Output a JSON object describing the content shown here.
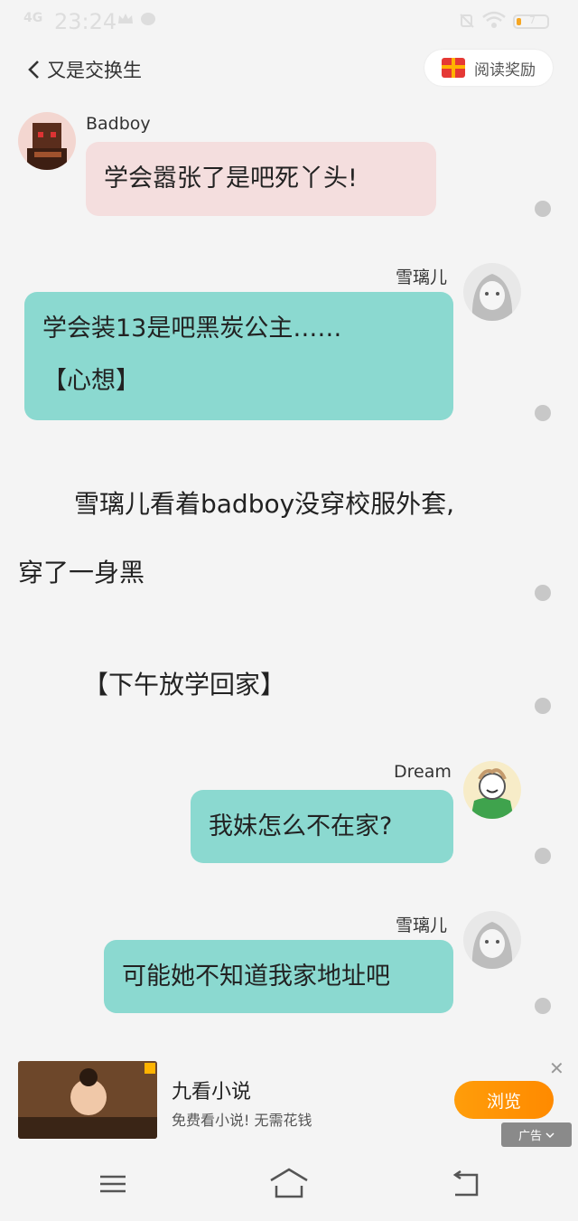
{
  "status": {
    "time": "23:24",
    "signal": "4G",
    "battery_text": "7"
  },
  "header": {
    "title": "又是交换生",
    "reward_label": "阅读奖励"
  },
  "messages": [
    {
      "name": "Badboy",
      "text": "学会嚣张了是吧死丫头!"
    },
    {
      "name": "雪璃儿",
      "line1": "学会装13是吧黑炭公主……",
      "line2": "【心想】"
    },
    {
      "name": "Dream",
      "text": "我妹怎么不在家?"
    },
    {
      "name": "雪璃儿",
      "text": "可能她不知道我家地址吧"
    }
  ],
  "narration": {
    "line1": "雪璃儿看着badboy没穿校服外套,",
    "line2": "穿了一身黑",
    "line3": "【下午放学回家】"
  },
  "ad": {
    "title": "九看小说",
    "subtitle": "免费看小说! 无需花钱",
    "button": "浏览",
    "tag": "广告"
  },
  "colors": {
    "teal": "#8bd9d0",
    "pink": "#f4dede",
    "accent": "#ff9d0a"
  }
}
